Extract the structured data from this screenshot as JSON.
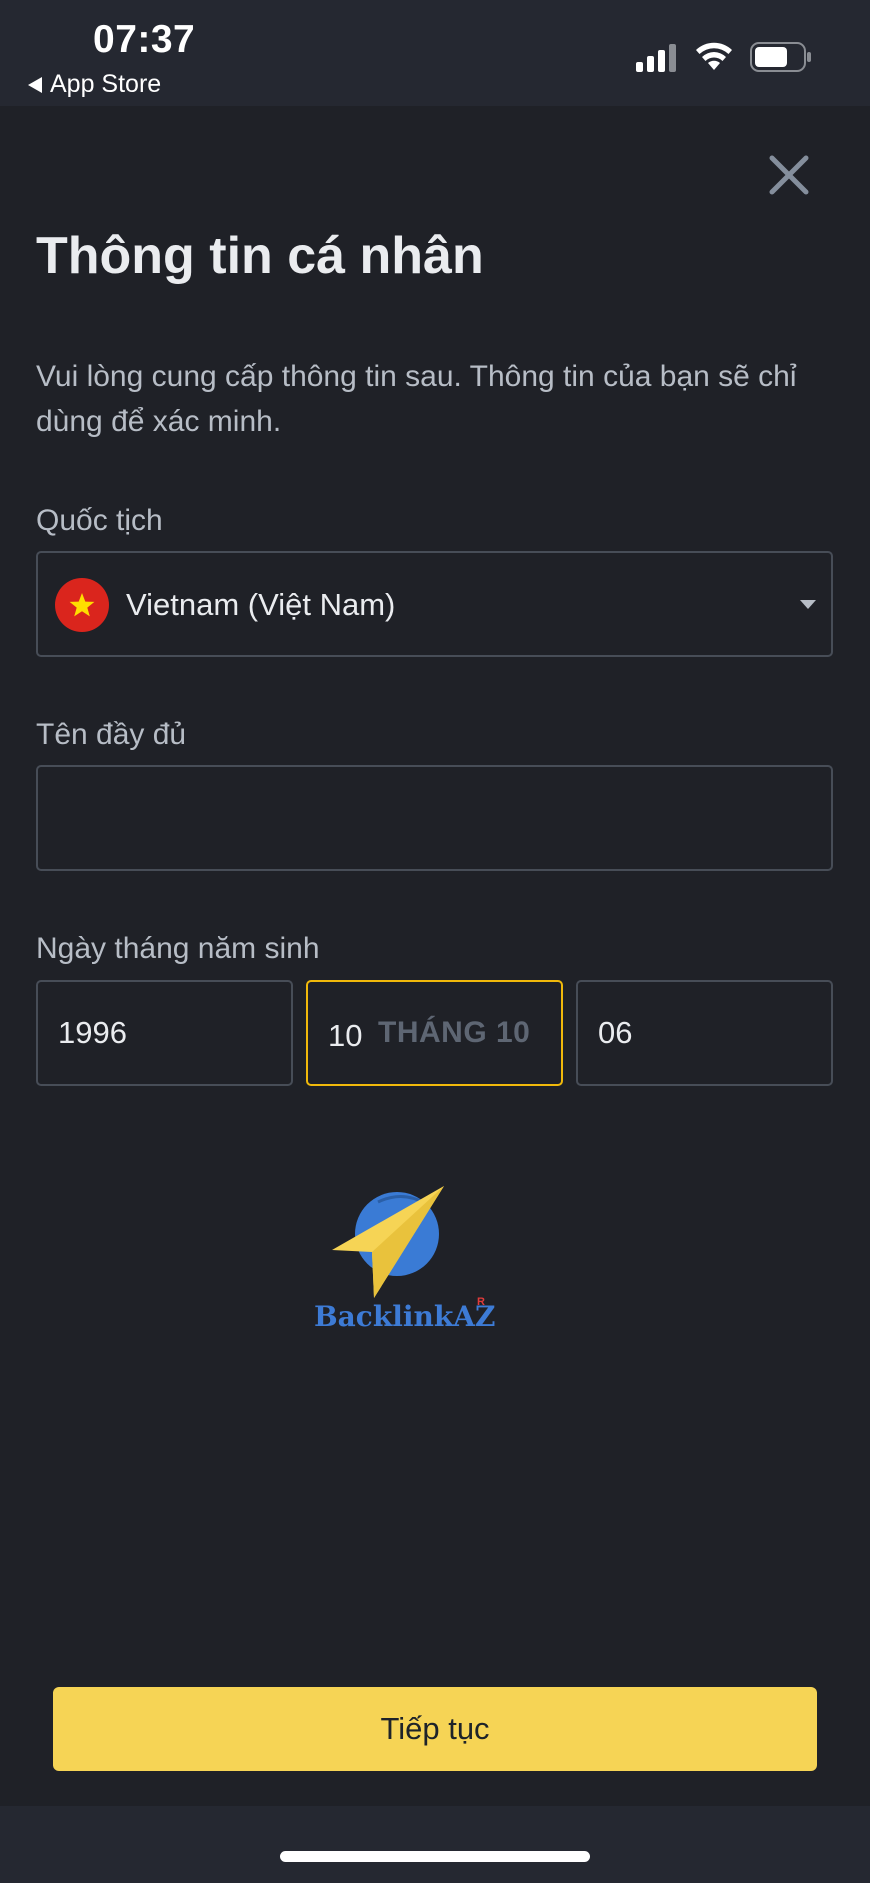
{
  "status_bar": {
    "time": "07:37",
    "back_app": "App Store",
    "signal_icon": "cellular-signal-icon",
    "wifi_icon": "wifi-icon",
    "battery_icon": "battery-icon"
  },
  "header": {
    "close_icon": "close-icon",
    "title": "Thông tin cá nhân",
    "description": "Vui lòng cung cấp thông tin sau. Thông tin của bạn sẽ chỉ dùng để xác minh."
  },
  "form": {
    "nationality": {
      "label": "Quốc tịch",
      "value": "Vietnam (Việt Nam)",
      "flag_icon": "vietnam-flag-icon",
      "dropdown_icon": "caret-down-icon"
    },
    "full_name": {
      "label": "Tên đầy đủ",
      "value": ""
    },
    "dob": {
      "label": "Ngày tháng năm sinh",
      "year": "1996",
      "month": "10",
      "month_hint": "THÁNG 10",
      "day": "06"
    }
  },
  "watermark": {
    "logo_icon": "backlinkaz-logo-icon",
    "text": "BacklinkAZ",
    "mark": "R"
  },
  "actions": {
    "continue_label": "Tiếp tục"
  },
  "colors": {
    "background": "#1f2127",
    "accent": "#f6d455",
    "focus_border": "#f0b90b",
    "border": "#474d57"
  }
}
